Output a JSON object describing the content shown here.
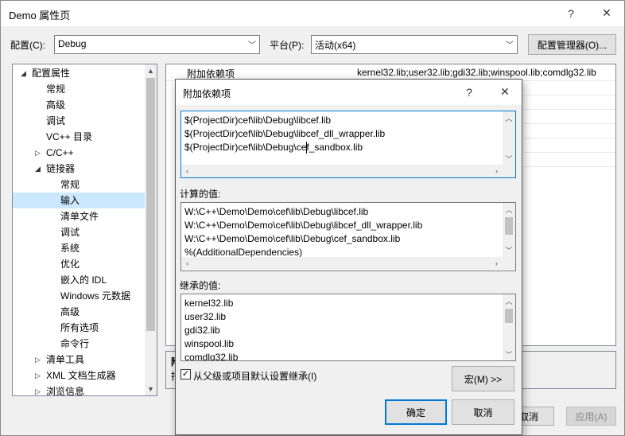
{
  "main": {
    "title": "Demo 属性页",
    "help_glyph": "?",
    "close_glyph": "✕",
    "config_label": "配置(C):",
    "config_value": "Debug",
    "platform_label": "平台(P):",
    "platform_value": "活动(x64)",
    "config_manager_label": "配置管理器(O)...",
    "cancel_label": "取消",
    "apply_label": "应用(A)"
  },
  "tree": {
    "items": [
      {
        "label": "配置属性",
        "exp": "◢"
      },
      {
        "label": "常规"
      },
      {
        "label": "高级"
      },
      {
        "label": "调试"
      },
      {
        "label": "VC++ 目录"
      },
      {
        "label": "C/C++",
        "exp": "▷"
      },
      {
        "label": "链接器",
        "exp": "◢"
      },
      {
        "label": "常规"
      },
      {
        "label": "输入"
      },
      {
        "label": "清单文件"
      },
      {
        "label": "调试"
      },
      {
        "label": "系统"
      },
      {
        "label": "优化"
      },
      {
        "label": "嵌入的 IDL"
      },
      {
        "label": "Windows 元数据"
      },
      {
        "label": "高级"
      },
      {
        "label": "所有选项"
      },
      {
        "label": "命令行"
      },
      {
        "label": "清单工具",
        "exp": "▷"
      },
      {
        "label": "XML 文档生成器",
        "exp": "▷"
      },
      {
        "label": "浏览信息",
        "exp": "▷"
      }
    ]
  },
  "grid": {
    "first_row": {
      "name": "附加依赖项",
      "value": "kernel32.lib;user32.lib;gdi32.lib;winspool.lib;comdlg32.lib"
    }
  },
  "desc": {
    "title_fragment": "附",
    "text_fragment": "指"
  },
  "dialog": {
    "title": "附加依赖项",
    "help_glyph": "?",
    "close_glyph": "✕",
    "edit_lines": [
      "$(ProjectDir)cef\\lib\\Debug\\libcef.lib",
      "$(ProjectDir)cef\\lib\\Debug\\libcef_dll_wrapper.lib",
      "$(ProjectDir)cef\\lib\\Debug\\cef_sandbox.lib"
    ],
    "computed_label": "计算的值:",
    "computed_lines": [
      "W:\\C++\\Demo\\Demo\\cef\\lib\\Debug\\libcef.lib",
      "W:\\C++\\Demo\\Demo\\cef\\lib\\Debug\\libcef_dll_wrapper.lib",
      "W:\\C++\\Demo\\Demo\\cef\\lib\\Debug\\cef_sandbox.lib",
      "%(AdditionalDependencies)"
    ],
    "inherited_label": "继承的值:",
    "inherited_lines": [
      "kernel32.lib",
      "user32.lib",
      "gdi32.lib",
      "winspool.lib",
      "comdlg32.lib"
    ],
    "inherit_checkbox_label": "从父级或项目默认设置继承(I)",
    "inherit_checked": true,
    "macro_label": "宏(M) >>",
    "ok_label": "确定",
    "cancel_label": "取消"
  },
  "colors": {
    "selection": "#cce8ff",
    "focus_border": "#0078d7",
    "window_bg": "#f0f0f0"
  }
}
